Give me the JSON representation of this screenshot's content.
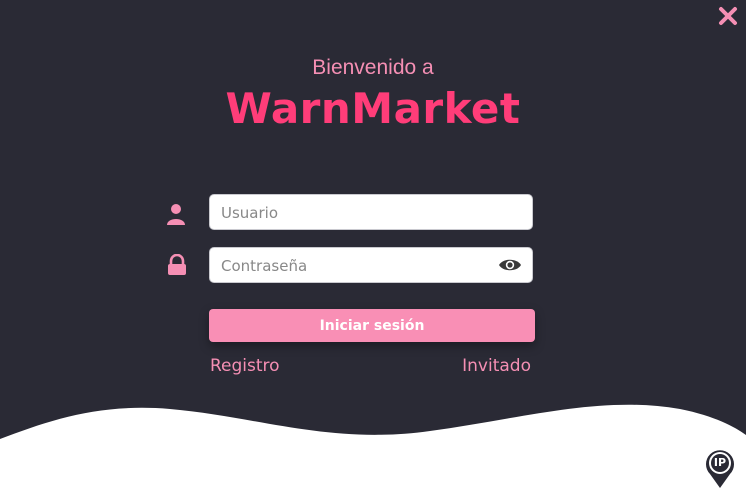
{
  "header": {
    "welcome_text": "Bienvenido a",
    "brand_name": "WarnMarket"
  },
  "form": {
    "username_placeholder": "Usuario",
    "password_placeholder": "Contraseña",
    "login_label": "Iniciar sesión",
    "register_label": "Registro",
    "guest_label": "Invitado"
  },
  "logo": {
    "text": "IP"
  },
  "colors": {
    "background": "#2a2a35",
    "accent": "#ff3d79",
    "accent_light": "#f98fb5",
    "wave": "#ffffff"
  },
  "icons": {
    "close": "close-icon",
    "user": "user-icon",
    "lock": "lock-icon",
    "eye": "eye-icon",
    "logo": "ip-location-logo"
  }
}
